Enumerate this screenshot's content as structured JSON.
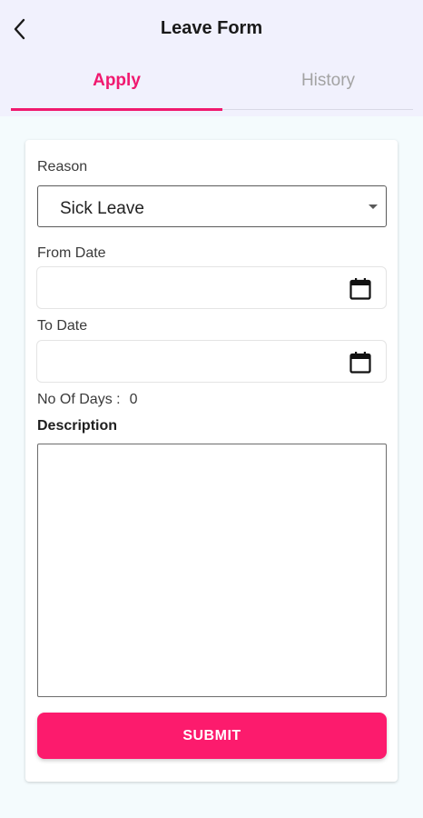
{
  "header": {
    "title": "Leave Form",
    "back_icon": "chevron-left-icon"
  },
  "tabs": [
    {
      "label": "Apply",
      "active": true
    },
    {
      "label": "History",
      "active": false
    }
  ],
  "form": {
    "reason_label": "Reason",
    "reason_value": "Sick Leave",
    "from_date_label": "From Date",
    "from_date_value": "",
    "to_date_label": "To Date",
    "to_date_value": "",
    "days_label": "No Of Days :",
    "days_value": "0",
    "description_label": "Description",
    "description_value": "",
    "submit_label": "SUBMIT"
  },
  "colors": {
    "accent": "#f0196f",
    "submit_bg": "#fc1b6d",
    "header_bg": "#f1f1fd",
    "page_bg": "#f4fbfd",
    "inactive_tab": "#a3a3a3"
  },
  "icons": {
    "select_arrow": "caret-down-icon",
    "date_picker": "calendar-icon"
  }
}
